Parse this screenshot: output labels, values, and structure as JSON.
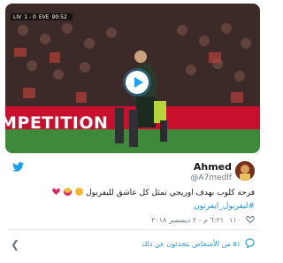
{
  "video": {
    "scorebug": [
      "LIV",
      "1 - 0",
      "EVE",
      "90:52"
    ],
    "banner_text": "MPETITION",
    "play_icon": "play-icon"
  },
  "tweet": {
    "author_name": "Ahmed",
    "author_handle": "@A7medlf",
    "text": "فرحة كلوب بهدف   اوريجي تمثل كل عاشق لليفربول",
    "emojis": [
      "crying-face",
      "heart-eyes",
      "red-heart"
    ],
    "hashtags": "#ليفربول_ايفرتون",
    "likes": "١١٠",
    "timestamp": "٦:٢١ م - ٢ ديسمبر ٢٠١٨",
    "footer_text": "٥١ من الأشخاص يتحدثون عن ذلك"
  },
  "colors": {
    "link": "#1b95e0",
    "twitter_blue": "#1da1f2",
    "text": "#14171a",
    "muted": "#657786"
  }
}
